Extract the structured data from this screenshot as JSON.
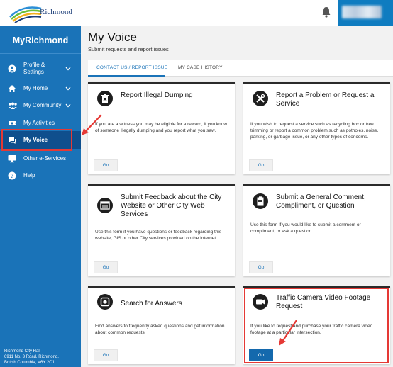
{
  "topbar": {
    "logo_text": "Richmond"
  },
  "sidebar": {
    "title": "MyRichmond",
    "items": [
      {
        "label": "Profile & Settings"
      },
      {
        "label": "My Home"
      },
      {
        "label": "My Community"
      },
      {
        "label": "My Activities"
      },
      {
        "label": "My Voice"
      },
      {
        "label": "Other e-Services"
      },
      {
        "label": "Help"
      }
    ],
    "footer": {
      "line1": "Richmond City Hall",
      "line2": "6911 No. 3 Road, Richmond,",
      "line3": "British Columbia, V6Y 2C1"
    }
  },
  "main": {
    "title": "My Voice",
    "subtitle": "Submit requests and report issues",
    "tabs": [
      {
        "label": "CONTACT US / REPORT ISSUE"
      },
      {
        "label": "MY CASE HISTORY"
      }
    ],
    "cards": [
      {
        "title": "Report Illegal Dumping",
        "body": "If you are a witness you may be eligible for a reward, if you know of someone illegally dumping and you report what you saw.",
        "button": "Go"
      },
      {
        "title": "Report a Problem or Request a Service",
        "body": "If you wish to request a service such as recycling box or tree trimming or report a common problem such as potholes, noise, parking, or garbage issue, or any other types of concerns.",
        "button": "Go"
      },
      {
        "title": "Submit Feedback about the City Website or Other City Web Services",
        "body": "Use this form if you have questions or feedback regarding this website, GIS or other City services provided on the Internet.",
        "button": "Go"
      },
      {
        "title": "Submit a General Comment, Compliment, or Question",
        "body": "Use this form if you would like to submit a comment or compliment, or ask a question.",
        "button": "Go"
      },
      {
        "title": "Search for Answers",
        "body": "Find answers to frequently asked questions and get information about common requests.",
        "button": "Go"
      },
      {
        "title": "Traffic Camera Video Footage Request",
        "body": "If you like to request and purchase your traffic camera video footage at a particular intersection.",
        "button": "Go"
      }
    ]
  },
  "colors": {
    "sidebar": "#1a73b8",
    "sidebar_active": "#0f4f8d",
    "accent": "#1a73b8",
    "annotation": "#e53935"
  }
}
